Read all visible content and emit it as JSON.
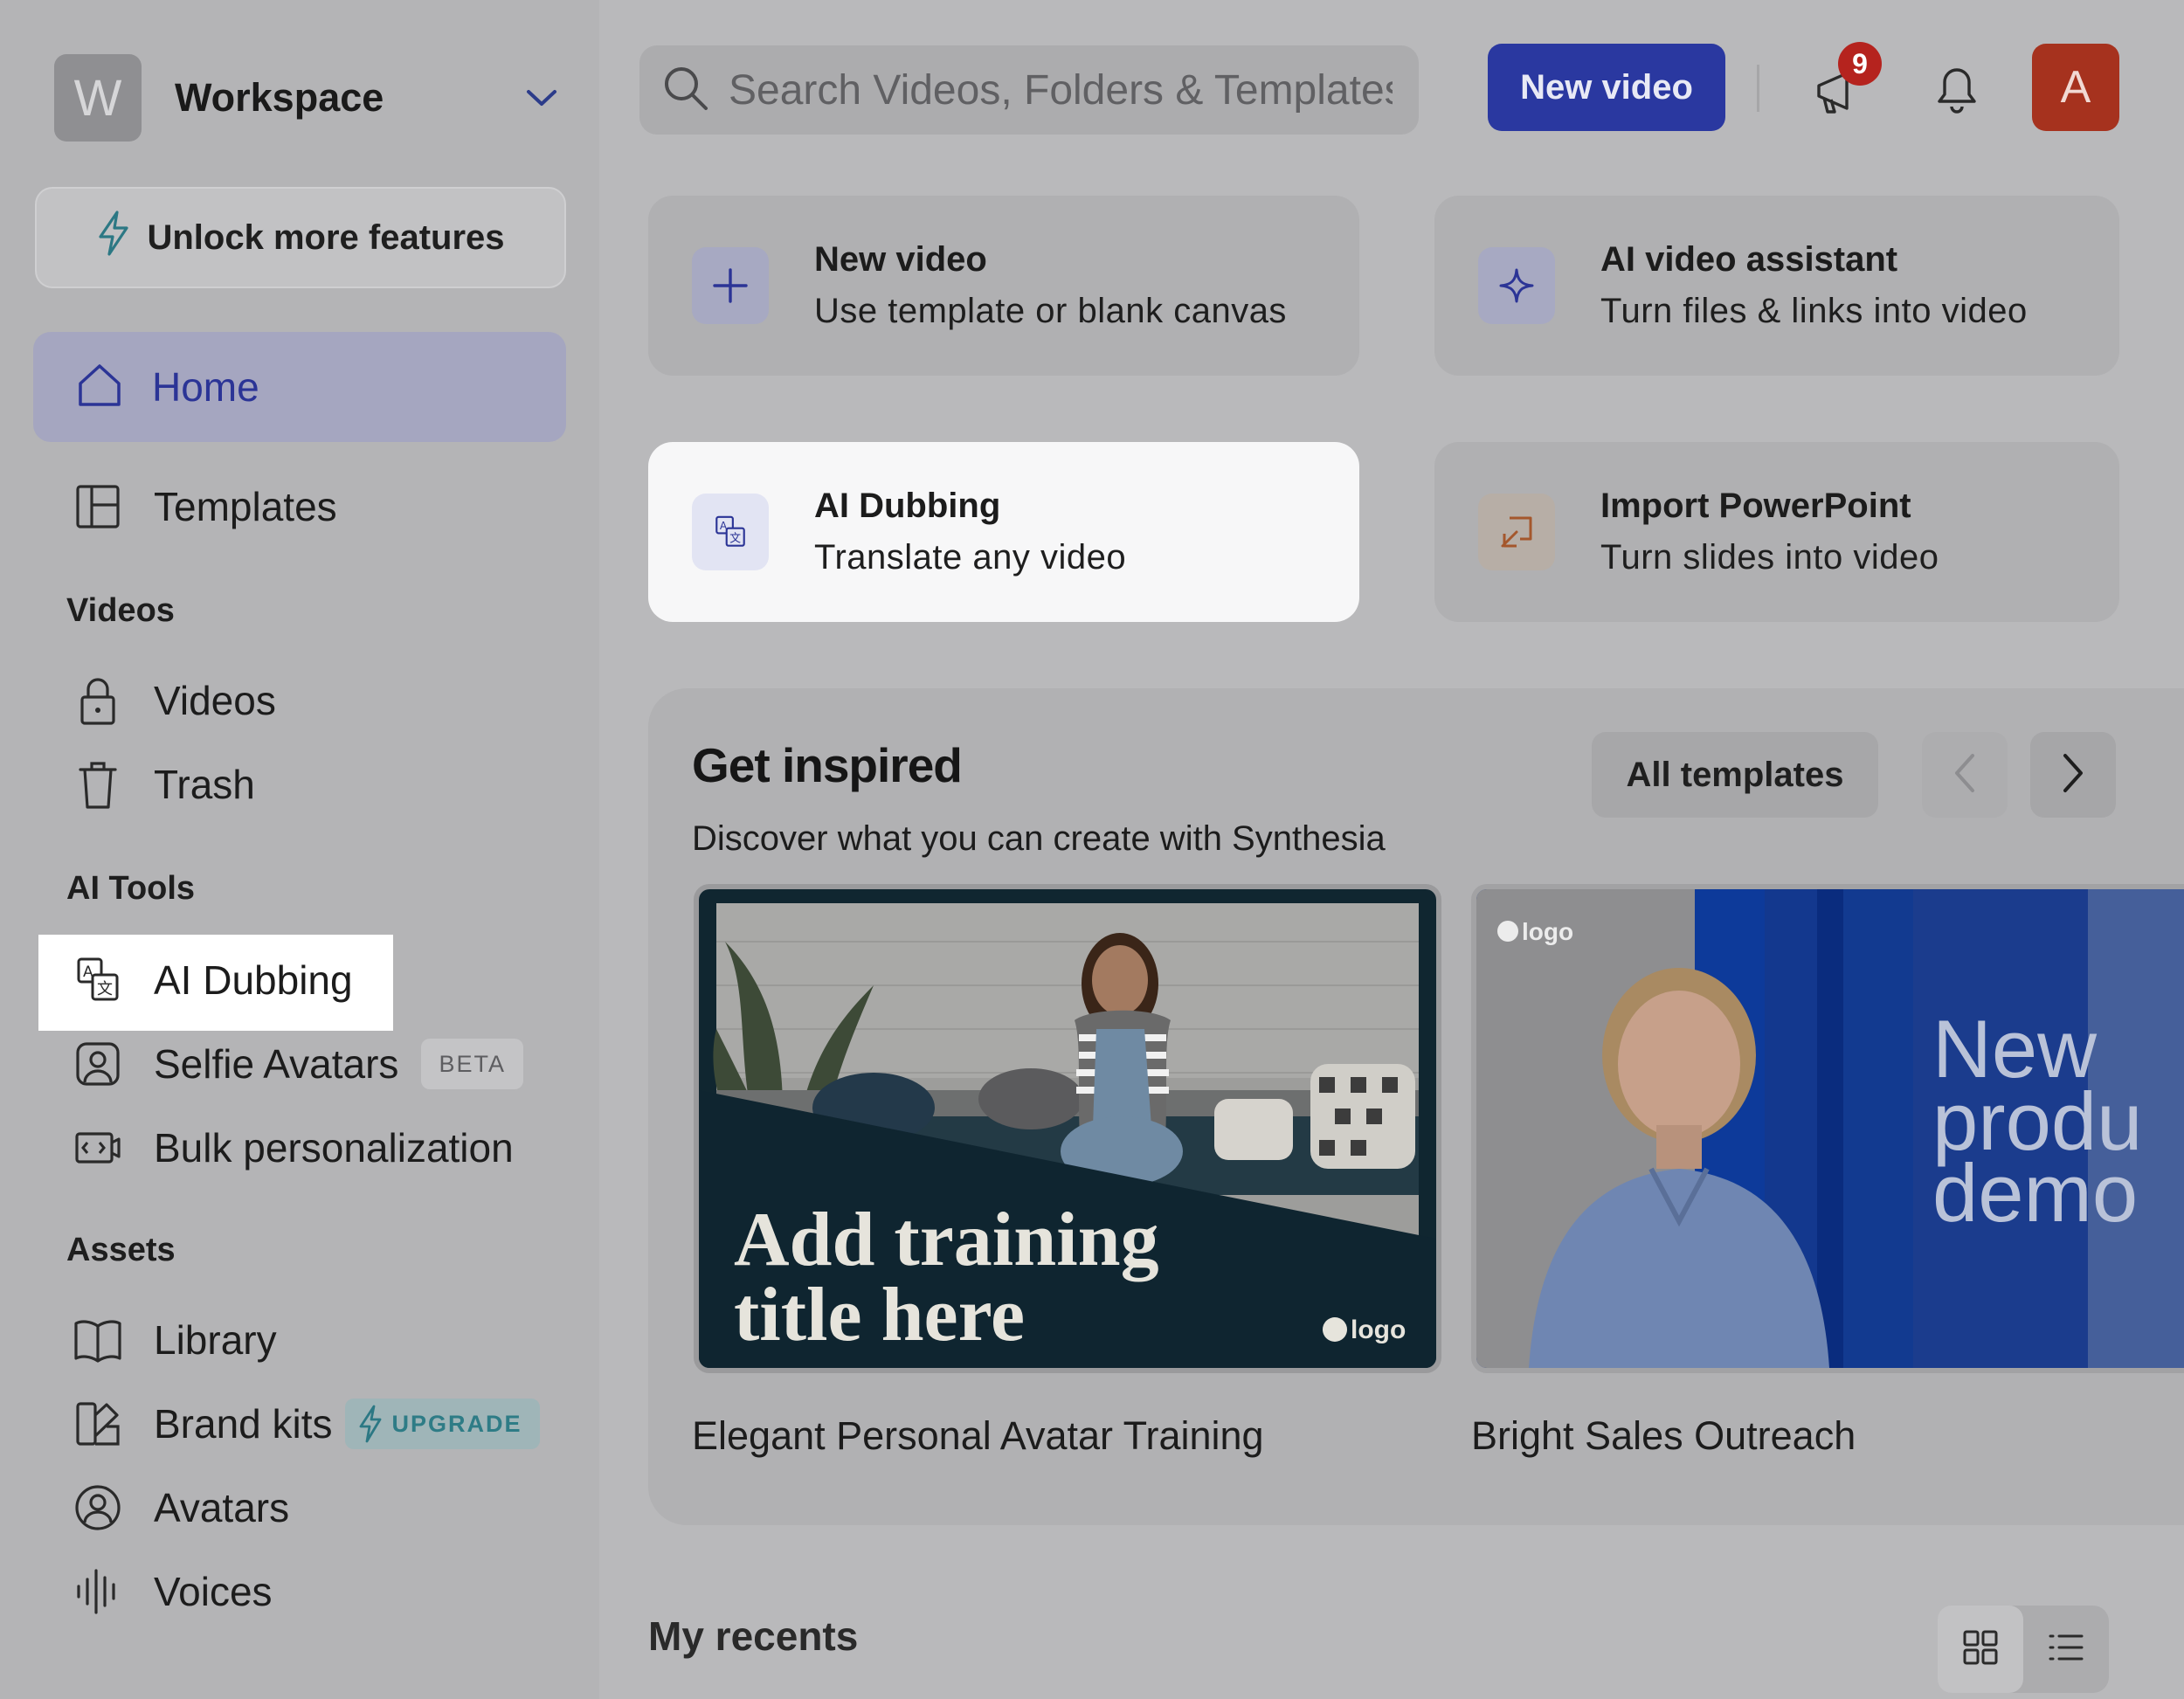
{
  "workspace": {
    "avatar_letter": "W",
    "name": "Workspace"
  },
  "sidebar": {
    "unlock_label": "Unlock more features",
    "home_label": "Home",
    "templates_label": "Templates",
    "videos_section": "Videos",
    "videos_label": "Videos",
    "trash_label": "Trash",
    "ai_tools_section": "AI Tools",
    "ai_dubbing_label": "AI Dubbing",
    "selfie_avatars_label": "Selfie Avatars",
    "selfie_badge": "BETA",
    "bulk_label": "Bulk personalization",
    "assets_section": "Assets",
    "library_label": "Library",
    "brand_kits_label": "Brand kits",
    "brand_badge": "UPGRADE",
    "avatars_label": "Avatars",
    "voices_label": "Voices"
  },
  "header": {
    "search_placeholder": "Search Videos, Folders & Templates",
    "new_video_label": "New video",
    "announcement_count": "9",
    "user_initial": "A"
  },
  "actions": [
    {
      "title": "New video",
      "subtitle": "Use template or blank canvas"
    },
    {
      "title": "AI video assistant",
      "subtitle": "Turn files & links into video"
    },
    {
      "title": "AI Dubbing",
      "subtitle": "Translate any video"
    },
    {
      "title": "Import PowerPoint",
      "subtitle": "Turn slides into video"
    }
  ],
  "inspired": {
    "title": "Get inspired",
    "subtitle": "Discover what you can create with Synthesia",
    "all_templates_label": "All templates",
    "templates": [
      {
        "name": "Elegant Personal Avatar Training",
        "thumb_title_1": "Add training",
        "thumb_title_2": "title here",
        "logo": "logo"
      },
      {
        "name": "Bright Sales Outreach",
        "thumb_title_1": "New",
        "thumb_title_2": "produ",
        "thumb_title_3": "demo",
        "logo": "logo"
      }
    ]
  },
  "recents": {
    "title": "My recents"
  },
  "colors": {
    "accent": "#2a38a0",
    "home_bg": "#a5a6c0",
    "badge": "#b5231e"
  }
}
